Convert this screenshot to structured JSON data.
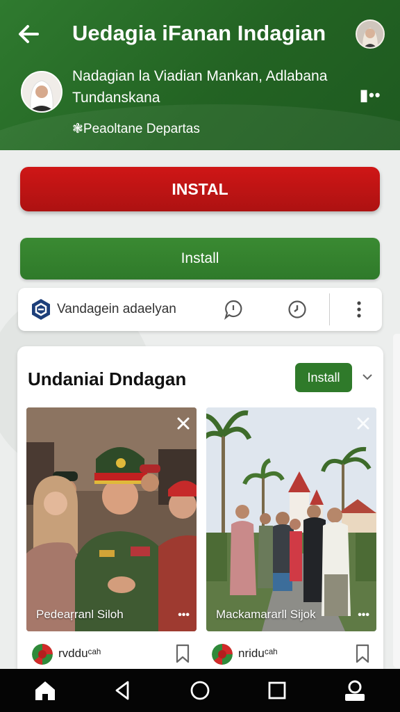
{
  "header": {
    "title": "Uedagia iFanan Indagian",
    "profile_name": "Nadagian la Viadian Mankan, Adlabana Tundanskana",
    "department": "❃Peaoltane Departas"
  },
  "buttons": {
    "primary_label": "INSTAL",
    "secondary_label": "Install"
  },
  "toolbar": {
    "label": "Vandagein adaelyan"
  },
  "card": {
    "title": "Undaniai Dndagan",
    "install_label": "Install",
    "items": [
      {
        "caption": "Pedeaŗranl Siloh",
        "source": "rvddu",
        "source_suffix": "ᶜᵃʰ"
      },
      {
        "caption": "Mackamararll Sijok",
        "source": "nridu",
        "source_suffix": "ᶜᵃʰ"
      }
    ]
  },
  "colors": {
    "header_green": "#236323",
    "install_red": "#c51414",
    "install_green": "#2f7a2a",
    "navbar": "#050505"
  },
  "icons": [
    "back-arrow-icon",
    "more-horizontal-icon",
    "logo-icon",
    "chat-icon",
    "clock-icon",
    "more-vertical-icon",
    "chevron-down-icon",
    "close-icon",
    "bookmark-icon",
    "home-icon",
    "back-triangle-icon",
    "circle-home-icon",
    "square-recents-icon",
    "profile-icon"
  ]
}
